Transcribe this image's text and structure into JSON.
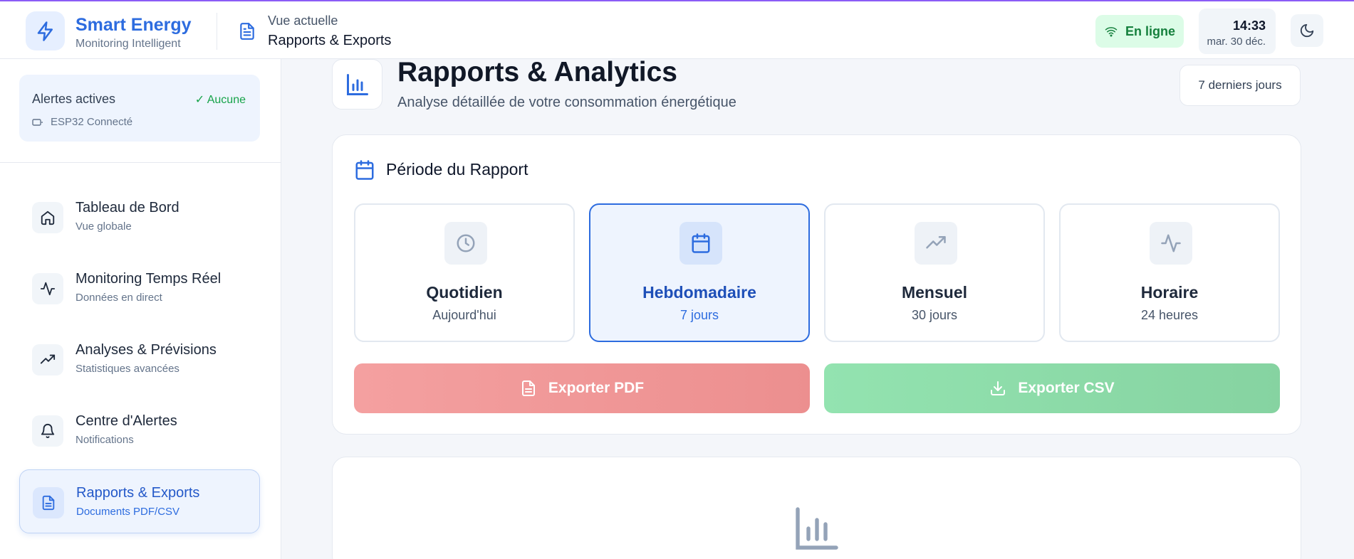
{
  "header": {
    "brand_title": "Smart Energy",
    "brand_subtitle": "Monitoring Intelligent",
    "current_view_label": "Vue actuelle",
    "current_view_value": "Rapports & Exports",
    "online_status": "En ligne",
    "clock_time": "14:33",
    "clock_date": "mar. 30 déc.",
    "colors": {
      "brand": "#2d6cdf",
      "online_bg": "#dcfce7",
      "online_text": "#15803d"
    }
  },
  "sidebar": {
    "alerts": {
      "title": "Alertes actives",
      "status": "✓ Aucune",
      "device": "ESP32 Connecté"
    },
    "items": [
      {
        "label": "Tableau de Bord",
        "sub": "Vue globale",
        "icon": "home-icon"
      },
      {
        "label": "Monitoring Temps Réel",
        "sub": "Données en direct",
        "icon": "activity-icon"
      },
      {
        "label": "Analyses & Prévisions",
        "sub": "Statistiques avancées",
        "icon": "trending-up-icon"
      },
      {
        "label": "Centre d'Alertes",
        "sub": "Notifications",
        "icon": "bell-icon"
      },
      {
        "label": "Rapports & Exports",
        "sub": "Documents PDF/CSV",
        "icon": "file-text-icon",
        "active": true
      }
    ]
  },
  "main": {
    "title": "Rapports & Analytics",
    "subtitle": "Analyse détaillée de votre consommation énergétique",
    "range_button": "7 derniers jours",
    "period": {
      "title": "Période du Rapport",
      "options": [
        {
          "label": "Quotidien",
          "sub": "Aujourd'hui",
          "icon": "clock-icon"
        },
        {
          "label": "Hebdomadaire",
          "sub": "7 jours",
          "icon": "calendar-icon",
          "selected": true
        },
        {
          "label": "Mensuel",
          "sub": "30 jours",
          "icon": "trending-up-icon"
        },
        {
          "label": "Horaire",
          "sub": "24 heures",
          "icon": "activity-icon"
        }
      ],
      "export_pdf": "Exporter PDF",
      "export_csv": "Exporter CSV"
    }
  }
}
